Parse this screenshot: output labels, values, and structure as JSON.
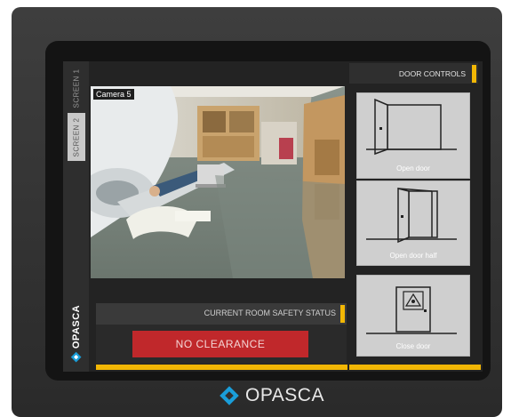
{
  "tabs": [
    {
      "label": "SCREEN 1"
    },
    {
      "label": "SCREEN 2"
    }
  ],
  "brand": {
    "name": "OPASCA",
    "icon": "opasca-logo-icon",
    "accent": "#1a9ed9"
  },
  "camera": {
    "label": "Camera 5"
  },
  "safety": {
    "title": "CURRENT ROOM SAFETY STATUS",
    "status": "NO CLEARANCE",
    "status_color": "#c0282b"
  },
  "door_controls": {
    "title": "DOOR CONTROLS",
    "buttons": [
      {
        "label": "Open door",
        "icon": "open-door-icon"
      },
      {
        "label": "Open door half",
        "icon": "half-open-door-icon"
      },
      {
        "label": "Close door",
        "icon": "closed-door-radiation-icon"
      }
    ]
  },
  "colors": {
    "accent": "#f2b705"
  }
}
